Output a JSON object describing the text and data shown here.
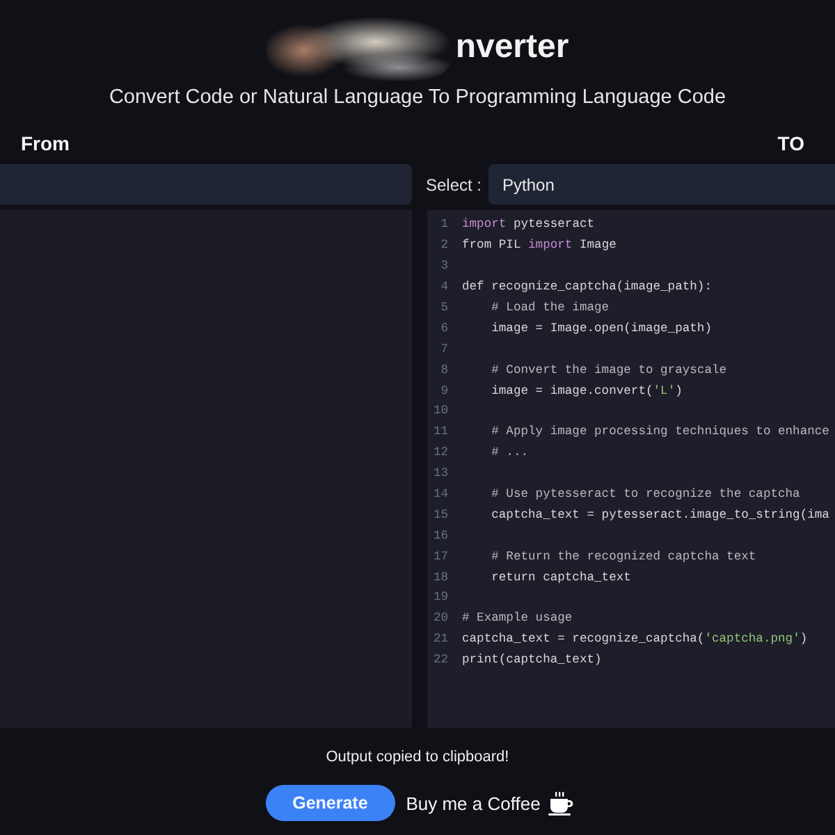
{
  "header": {
    "title": "nverter",
    "subtitle": "Convert Code or Natural Language To Programming Language Code"
  },
  "columns": {
    "from_label": "From",
    "to_label": "TO"
  },
  "target_language": {
    "label": "Select :",
    "value": "Python"
  },
  "output_code": {
    "lines": [
      {
        "number": "1",
        "segments": [
          {
            "kind": "keyword",
            "text": "import"
          },
          {
            "kind": "plain",
            "text": " pytesseract"
          }
        ]
      },
      {
        "number": "2",
        "segments": [
          {
            "kind": "plain",
            "text": "from PIL "
          },
          {
            "kind": "keyword",
            "text": "import"
          },
          {
            "kind": "plain",
            "text": " Image"
          }
        ]
      },
      {
        "number": "3"
      },
      {
        "number": "4",
        "segments": [
          {
            "kind": "plain",
            "text": "def recognize_captcha(image_path):"
          }
        ]
      },
      {
        "number": "5",
        "segments": [
          {
            "kind": "comment",
            "text": "    # Load the image"
          }
        ]
      },
      {
        "number": "6",
        "segments": [
          {
            "kind": "plain",
            "text": "    image = Image.open(image_path)"
          }
        ]
      },
      {
        "number": "7"
      },
      {
        "number": "8",
        "segments": [
          {
            "kind": "comment",
            "text": "    # Convert the image to grayscale"
          }
        ]
      },
      {
        "number": "9",
        "segments": [
          {
            "kind": "plain",
            "text": "    image = image.convert("
          },
          {
            "kind": "string",
            "text": "'L'"
          },
          {
            "kind": "plain",
            "text": ")"
          }
        ]
      },
      {
        "number": "10"
      },
      {
        "number": "11",
        "segments": [
          {
            "kind": "comment",
            "text": "    # Apply image processing techniques to enhance"
          }
        ]
      },
      {
        "number": "12",
        "segments": [
          {
            "kind": "comment",
            "text": "    # ..."
          }
        ]
      },
      {
        "number": "13"
      },
      {
        "number": "14",
        "segments": [
          {
            "kind": "comment",
            "text": "    # Use pytesseract to recognize the captcha"
          }
        ]
      },
      {
        "number": "15",
        "segments": [
          {
            "kind": "plain",
            "text": "    captcha_text = pytesseract.image_to_string(ima"
          }
        ]
      },
      {
        "number": "16"
      },
      {
        "number": "17",
        "segments": [
          {
            "kind": "comment",
            "text": "    # Return the recognized captcha text"
          }
        ]
      },
      {
        "number": "18",
        "segments": [
          {
            "kind": "plain",
            "text": "    return captcha_text"
          }
        ]
      },
      {
        "number": "19"
      },
      {
        "number": "20",
        "segments": [
          {
            "kind": "comment",
            "text": "# Example usage"
          }
        ]
      },
      {
        "number": "21",
        "segments": [
          {
            "kind": "plain",
            "text": "captcha_text = recognize_captcha("
          },
          {
            "kind": "string",
            "text": "'captcha.png'"
          },
          {
            "kind": "plain",
            "text": ")"
          }
        ]
      },
      {
        "number": "22",
        "segments": [
          {
            "kind": "plain",
            "text": "print(captcha_text)"
          }
        ]
      }
    ]
  },
  "status_message": "Output copied to clipboard!",
  "actions": {
    "generate": "Generate",
    "coffee_link": "Buy me a Coffee"
  }
}
